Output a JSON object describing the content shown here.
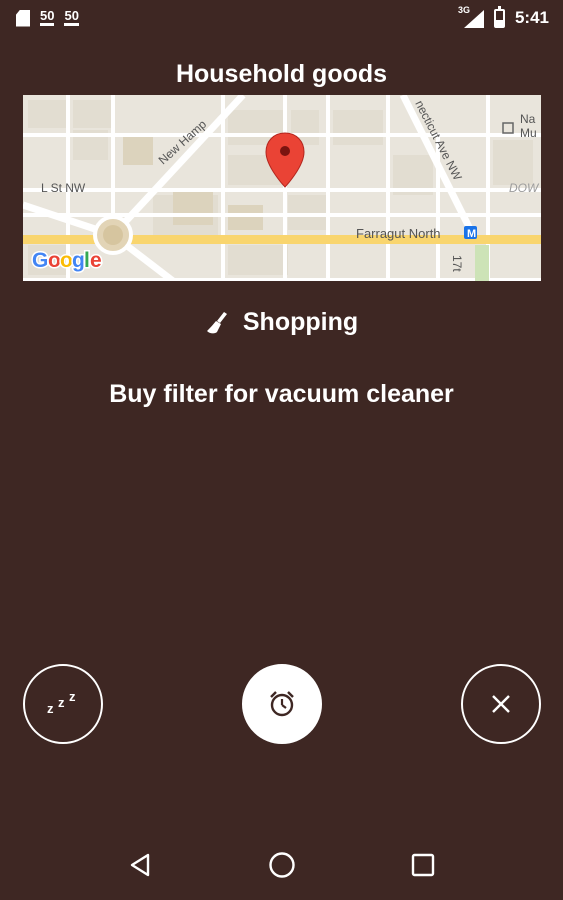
{
  "status_bar": {
    "notif_1": "50",
    "notif_2": "50",
    "network_type": "3G",
    "time": "5:41",
    "battery_level_percent": 40
  },
  "title": "Household goods",
  "map": {
    "labels": {
      "new_hampshire": "New Hamp",
      "connecticut": "necticut Ave NW",
      "l_st": "L St NW",
      "farragut": "Farragut North",
      "nat_mu_1": "Na",
      "nat_mu_2": "Mu",
      "dow": "DOW",
      "seventeenth": "17t",
      "google": "Google"
    },
    "colors": {
      "land": "#e9e5dc",
      "road": "#ffffff",
      "highway": "#f9d56e",
      "pin": "#ea4335",
      "block": "#ddd8cc"
    }
  },
  "category": {
    "label": "Shopping",
    "icon": "broom-icon"
  },
  "reminder": {
    "text": "Buy filter for vacuum cleaner"
  },
  "actions": {
    "snooze_icon": "snooze-icon",
    "alarm_icon": "alarm-clock-icon",
    "dismiss_icon": "close-icon"
  },
  "nav": {
    "back": "back-icon",
    "home": "home-icon",
    "recents": "recents-icon"
  }
}
